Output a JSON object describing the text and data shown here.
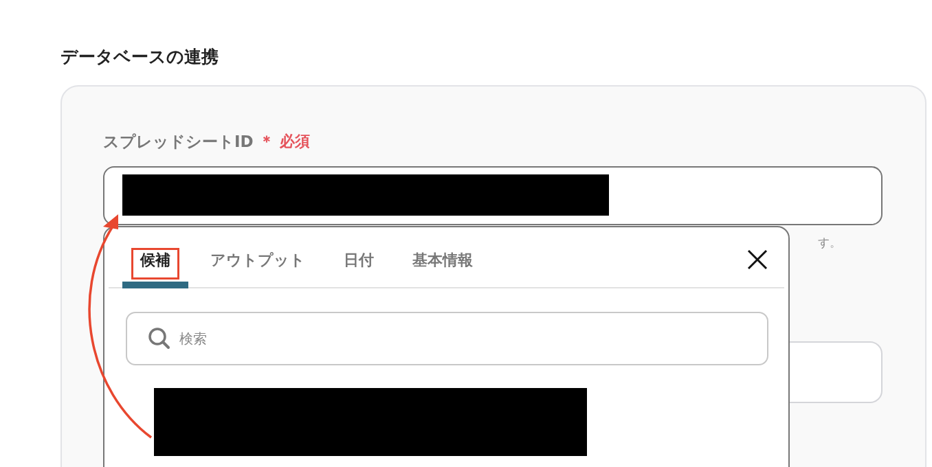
{
  "section_title": "データベースの連携",
  "form": {
    "field": {
      "label": "スプレッドシートID",
      "required_mark": "＊",
      "required_text": "必須",
      "help_text": "す。"
    }
  },
  "popup": {
    "tabs": [
      {
        "label": "候補",
        "selected": true,
        "highlighted": true
      },
      {
        "label": "アウトプット",
        "selected": false,
        "highlighted": false
      },
      {
        "label": "日付",
        "selected": false,
        "highlighted": false
      },
      {
        "label": "基本情報",
        "selected": false,
        "highlighted": false
      }
    ],
    "search": {
      "placeholder": "検索"
    }
  }
}
